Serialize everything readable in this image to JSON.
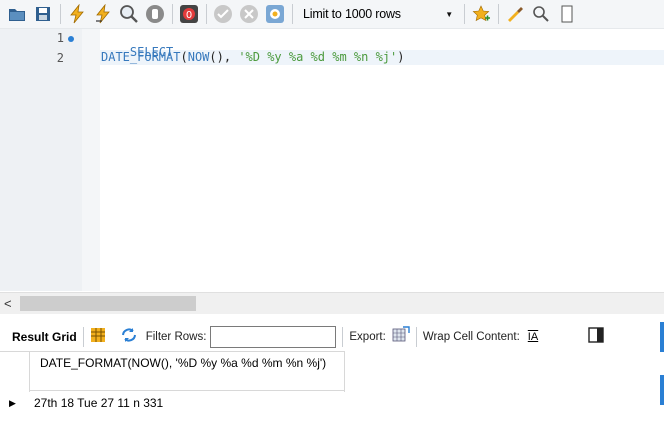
{
  "toolbar": {
    "limit_label": "Limit to 1000 rows",
    "icons": [
      "folder-icon",
      "save-icon",
      "execute-icon",
      "execute-current-icon",
      "explain-icon",
      "stop-icon",
      "toggle-error-icon",
      "commit-icon",
      "rollback-icon",
      "autocommit-icon",
      "limit-dropdown",
      "bookmark-icon",
      "beautify-icon",
      "find-icon"
    ]
  },
  "editor": {
    "lines": [
      {
        "number": "1",
        "text": "SELECT"
      },
      {
        "number": "2",
        "fn": "DATE_FORMAT",
        "open": "(",
        "fn2": "NOW",
        "args": "(), ",
        "str": "'%D %y %a %d %m %n %j'",
        "close": ")"
      }
    ]
  },
  "results": {
    "result_grid_label": "Result Grid",
    "filter_label": "Filter Rows:",
    "filter_value": "",
    "export_label": "Export:",
    "wrap_label": "Wrap Cell Content:",
    "columns": [
      "DATE_FORMAT(NOW(), '%D %y %a %d %m %n %j')"
    ],
    "rows": [
      [
        "27th 18 Tue 27 11 n 331"
      ]
    ]
  },
  "colors": {
    "keyword": "#3779bd",
    "string": "#4b9a3d",
    "accent": "#2a7fd4"
  }
}
